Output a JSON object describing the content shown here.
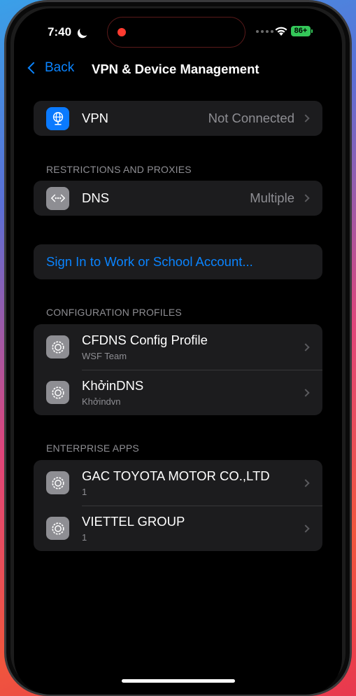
{
  "status_bar": {
    "time": "7:40",
    "battery": "86+"
  },
  "nav": {
    "back_label": "Back",
    "title": "VPN & Device Management"
  },
  "vpn": {
    "label": "VPN",
    "value": "Not Connected"
  },
  "restrictions": {
    "header": "RESTRICTIONS AND PROXIES",
    "dns_label": "DNS",
    "dns_value": "Multiple"
  },
  "account": {
    "sign_in_label": "Sign In to Work or School Account..."
  },
  "profiles": {
    "header": "CONFIGURATION PROFILES",
    "items": [
      {
        "title": "CFDNS Config Profile",
        "subtitle": "WSF Team"
      },
      {
        "title": "KhởinDNS",
        "subtitle": "Khởindvn"
      }
    ]
  },
  "enterprise": {
    "header": "ENTERPRISE APPS",
    "items": [
      {
        "title": "GAC TOYOTA MOTOR CO.,LTD",
        "subtitle": "1"
      },
      {
        "title": "VIETTEL GROUP",
        "subtitle": "1"
      }
    ]
  },
  "colors": {
    "accent": "#0a84ff",
    "group_bg": "#1c1c1e",
    "secondary_text": "#8e8e93",
    "battery": "#34c759"
  },
  "icons": {
    "vpn": "globe-network-icon",
    "dns": "dns-dots-icon",
    "profile": "gear-icon"
  }
}
